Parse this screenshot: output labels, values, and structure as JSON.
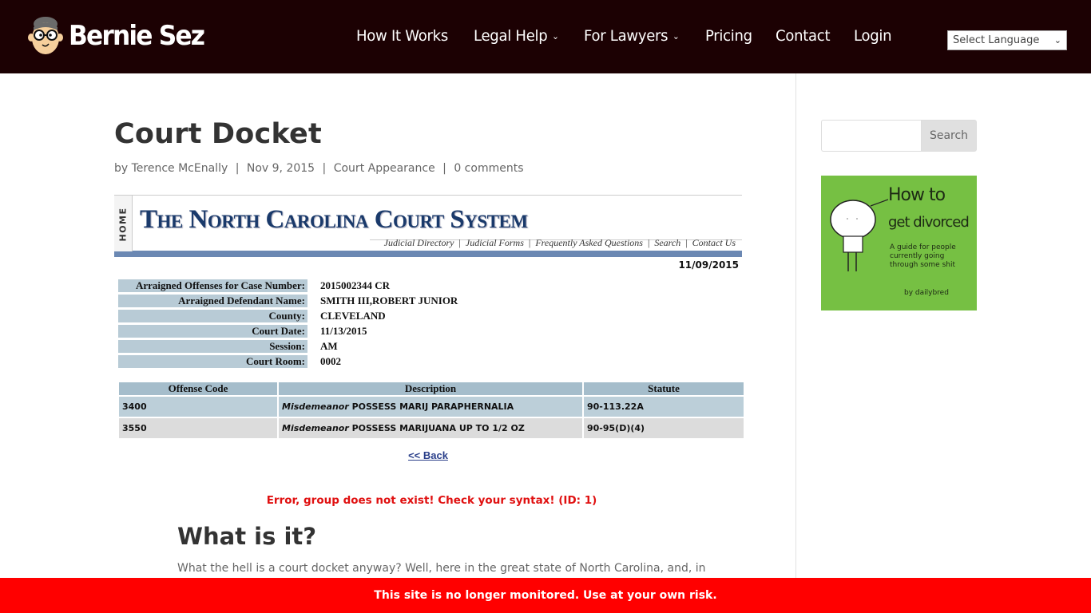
{
  "header": {
    "brand": "Bernie Sez",
    "nav": [
      {
        "label": "How It Works",
        "has_dropdown": false
      },
      {
        "label": "Legal Help",
        "has_dropdown": true
      },
      {
        "label": "For Lawyers",
        "has_dropdown": true
      },
      {
        "label": "Pricing",
        "has_dropdown": false
      },
      {
        "label": "Contact",
        "has_dropdown": false
      },
      {
        "label": "Login",
        "has_dropdown": false
      }
    ],
    "language_select": "Select Language"
  },
  "post": {
    "title": "Court Docket",
    "meta": {
      "by": "by",
      "author": "Terence McEnally",
      "date": "Nov 9, 2015",
      "category": "Court Appearance",
      "comments": "0 comments",
      "separator": "|"
    }
  },
  "court": {
    "home_tab": "HOME",
    "title": "The North Carolina Court System",
    "links": [
      "Judicial Directory",
      "Judicial Forms",
      "Frequently Asked Questions",
      "Search",
      "Contact Us"
    ],
    "link_separator": "|",
    "date": "11/09/2015",
    "info": [
      {
        "label": "Arraigned Offenses for Case Number:",
        "value": "2015002344 CR"
      },
      {
        "label": "Arraigned Defendant Name:",
        "value": "SMITH III,ROBERT JUNIOR"
      },
      {
        "label": "County:",
        "value": "CLEVELAND"
      },
      {
        "label": "Court Date:",
        "value": "11/13/2015"
      },
      {
        "label": "Session:",
        "value": "AM"
      },
      {
        "label": "Court Room:",
        "value": "0002"
      }
    ],
    "offense_columns": [
      "Offense Code",
      "Description",
      "Statute"
    ],
    "offenses": [
      {
        "code": "3400",
        "class": "Misdemeanor",
        "description": "POSSESS MARIJ PARAPHERNALIA",
        "statute": "90-113.22A"
      },
      {
        "code": "3550",
        "class": "Misdemeanor",
        "description": "POSSESS MARIJUANA UP TO 1/2 OZ",
        "statute": "90-95(D)(4)"
      }
    ],
    "back_link": "<< Back"
  },
  "error_message": "Error, group does not exist! Check your syntax! (ID: 1)",
  "section": {
    "heading": "What is it?",
    "paragraph": "What the hell is a court docket anyway? Well, here in the great state of North Carolina, and, in"
  },
  "sidebar": {
    "search_placeholder": "",
    "search_button": "Search",
    "ad": {
      "line1": "How to",
      "line2": "get divorced",
      "line3": "A guide for people currently going through some shit",
      "line4": "by dailybred",
      "bg_color": "#76c043"
    }
  },
  "notice": "This site is no longer monitored. Use at your own risk.",
  "colors": {
    "header_bg": "#1c0103",
    "notice_bg": "#ff0000",
    "error_text": "#e01010",
    "court_blue": "#1a3a6b"
  }
}
